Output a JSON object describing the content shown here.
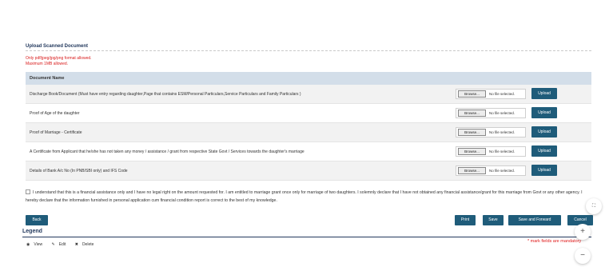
{
  "panel": {
    "title": "Upload Scanned Document",
    "notes": [
      "Only pdf/jpeg/jpg/png format allowed.",
      "Maximum 1MB allowed."
    ]
  },
  "table": {
    "header": "Document Name",
    "rows": [
      {
        "name": "Discharge Book/Document (Must have entry regarding daughter,Page that contains ESM/Personal Particulars,Service Particulars and Family Particulars )"
      },
      {
        "name": "Proof of Age of the daughter"
      },
      {
        "name": "Proof of Marriage - Certificate"
      },
      {
        "name": "A Certificate from Applicant that he/she has not taken any money / assistance / grant from respective State Govt / Services towards the daughter's marriage"
      },
      {
        "name": "Details of Bank A/c No (In PNB/SBI only) and IFS Code"
      }
    ],
    "browse_label": "Browse...",
    "file_status": "No file selected.",
    "upload_label": "Upload"
  },
  "declaration": {
    "text": "I understand that this is a financial assistance only and I have no legal right on the amount requested for. I am entitled to marriage grant once only for marriage of two daughters. I solemnly declare that I have not obtained any financial assistance/grant for this marriage from Govt or any other agency. I hereby declare that the information furnished in personal application cum financial condition report is correct to the best of my knowledge."
  },
  "actions": {
    "back": "Back",
    "print": "Print",
    "save": "Save",
    "save_forward": "Save and Forward",
    "cancel": "Cancel"
  },
  "legend": {
    "title": "Legend",
    "view": "View",
    "edit": "Edit",
    "delete": "Delete"
  },
  "mandatory_note": "* mark fields are mandatory",
  "colors": {
    "primary_button": "#1f5c7a",
    "table_header": "#d3dee9",
    "error_text": "#d91c1c",
    "title_text": "#23395d"
  },
  "icons": {
    "view": "eye-icon",
    "edit": "edit-icon",
    "delete": "delete-icon",
    "fullscreen": "fullscreen-icon",
    "zoom_in": "plus-icon",
    "zoom_out": "minus-icon"
  }
}
